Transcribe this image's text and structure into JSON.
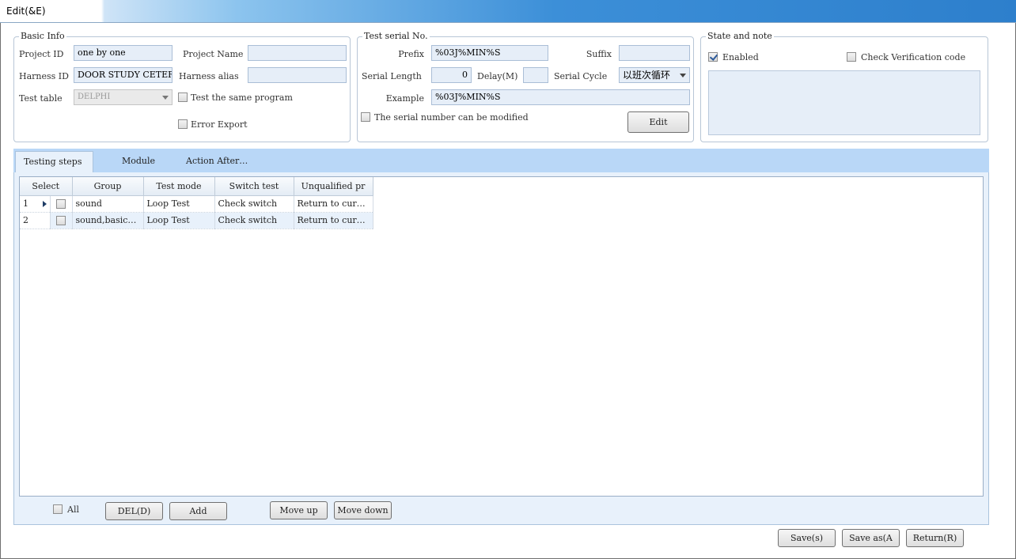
{
  "window": {
    "title": "Edit(&E)"
  },
  "basic_info": {
    "legend": "Basic Info",
    "project_id_label": "Project ID",
    "project_id_value": "one by one",
    "project_name_label": "Project Name",
    "project_name_value": "",
    "harness_id_label": "Harness ID",
    "harness_id_value": "DOOR STUDY CETER",
    "harness_alias_label": "Harness alias",
    "harness_alias_value": "",
    "test_table_label": "Test table",
    "test_table_value": "DELPHI",
    "same_program_label": "Test the same program",
    "same_program_checked": false,
    "error_export_label": "Error Export",
    "error_export_checked": false
  },
  "serial": {
    "legend": "Test serial No.",
    "prefix_label": "Prefix",
    "prefix_value": "%03J%MIN%S",
    "suffix_label": "Suffix",
    "suffix_value": "",
    "serial_length_label": "Serial Length",
    "serial_length_value": "0",
    "delay_label": "Delay(M)",
    "delay_value": "",
    "serial_cycle_label": "Serial Cycle",
    "serial_cycle_value": "以班次循环",
    "example_label": "Example",
    "example_value": "%03J%MIN%S",
    "modifiable_label": "The serial number can be modified",
    "modifiable_checked": false,
    "edit_button": "Edit"
  },
  "state": {
    "legend": "State and note",
    "enabled_label": "Enabled",
    "enabled_checked": true,
    "verification_label": "Check Verification code",
    "verification_checked": false
  },
  "tabs": [
    {
      "label": "Testing steps",
      "active": true
    },
    {
      "label": "Module",
      "active": false
    },
    {
      "label": "Action After…",
      "active": false
    }
  ],
  "grid": {
    "columns": [
      "Select",
      "Group",
      "Test mode",
      "Switch test",
      "Unqualified pr"
    ],
    "rows": [
      {
        "index": "1",
        "group": "sound",
        "test_mode": "Loop Test",
        "switch_test": "Check switch",
        "unqualified": "Return to cur…",
        "current": true
      },
      {
        "index": "2",
        "group": "sound,basic…",
        "test_mode": "Loop Test",
        "switch_test": "Check switch",
        "unqualified": "Return to cur…",
        "current": false
      }
    ]
  },
  "grid_toolbar": {
    "all_label": "All",
    "del_button": "DEL(D)",
    "add_button": "Add",
    "move_up_button": "Move up",
    "move_down_button": "Move down"
  },
  "footer": {
    "save_button": "Save(s)",
    "save_as_button": "Save as(A",
    "return_button": "Return(R)"
  }
}
